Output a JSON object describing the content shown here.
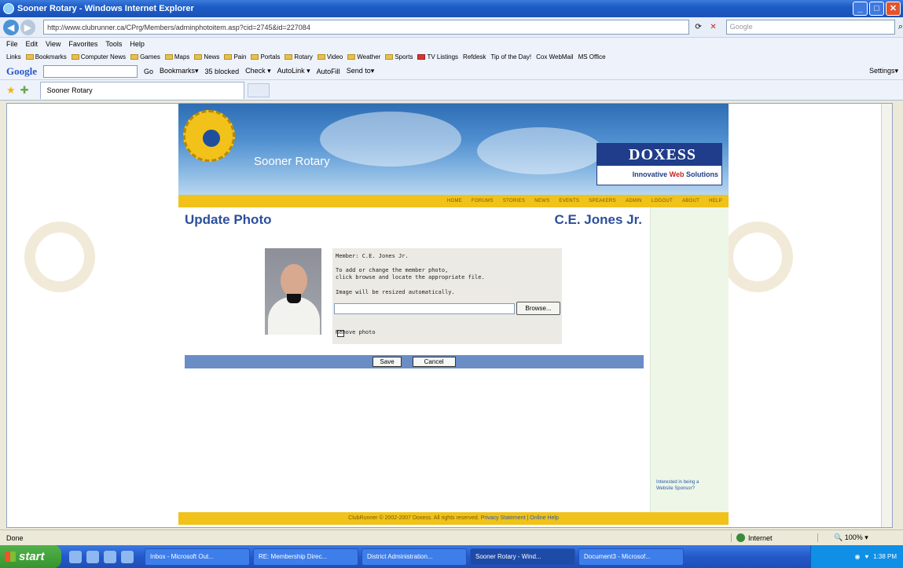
{
  "window": {
    "title": "Sooner Rotary - Windows Internet Explorer",
    "minimize": "_",
    "maximize": "□",
    "close": "✕"
  },
  "browser": {
    "back": "◀",
    "forward": "▶",
    "address": "http://www.clubrunner.ca/CPrg/Members/adminphotoitem.asp?cid=2745&id=227084",
    "search_placeholder": "Google",
    "menu": [
      "File",
      "Edit",
      "View",
      "Favorites",
      "Tools",
      "Help"
    ],
    "links_label": "Links",
    "links": [
      "Bookmarks",
      "Computer News",
      "Games",
      "Maps",
      "News",
      "Pain",
      "Portals",
      "Rotary",
      "Video",
      "Weather",
      "Sports",
      "TV Listings",
      "Refdesk",
      "Tip of the Day!",
      "Cox WebMail",
      "MS Office"
    ],
    "google_logo": "Google",
    "google_items": [
      "Go",
      "Bookmarks▾",
      "35 blocked",
      "Check ▾",
      "AutoLink ▾",
      "AutoFill",
      "Send to▾",
      "Settings▾"
    ],
    "tab_title": "Sooner Rotary",
    "status_left": "Done",
    "zone": "Internet",
    "zoom": "100%"
  },
  "site": {
    "title": "Sooner Rotary",
    "sponsor_logo": "DOXESS",
    "sponsor_tag_1": "Innovative",
    "sponsor_tag_2": "Web",
    "sponsor_tag_3": "Solutions",
    "nav": [
      "HOME",
      "FORUMS",
      "STORIES",
      "NEWS",
      "EVENTS",
      "SPEAKERS",
      "ADMIN",
      "LOGOUT",
      "ABOUT",
      "HELP"
    ],
    "sidebar_sponsor": "Interested in being a Website Sponsor?",
    "footer_text": "ClubRunner © 2002-2007 Doxess. All rights reserved.",
    "footer_privacy": "Privacy Statement",
    "footer_sep": "|",
    "footer_help": "Online Help"
  },
  "page": {
    "heading": "Update Photo",
    "member_name": "C.E. Jones Jr.",
    "form": {
      "member_line": "Member: C.E. Jones Jr.",
      "instruction_1": "To add or change the member photo,",
      "instruction_2": "click browse and locate the appropriate file.",
      "resize_note": "Image will be resized automatically.",
      "file_value": "",
      "browse_label": "Browse...",
      "remove_label": "Remove photo",
      "remove_checked": false
    },
    "save_label": "Save",
    "cancel_label": "Cancel"
  },
  "taskbar": {
    "start_label": "start",
    "items": [
      "Inbox - Microsoft Out...",
      "RE: Membership Direc...",
      "District Administration...",
      "Sooner Rotary - Wind...",
      "Document3 - Microsof..."
    ],
    "active_index": 3,
    "clock": "1:38 PM"
  }
}
